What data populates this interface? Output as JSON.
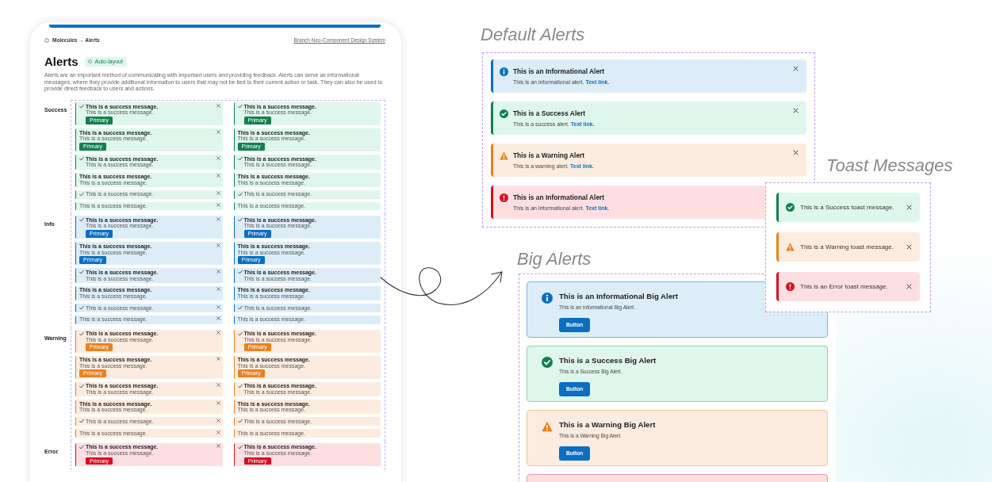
{
  "doc_page": {
    "breadcrumb": "Molecules → Alerts",
    "branch_link": "Branch Neo-Component Design System",
    "title": "Alerts",
    "badge": "Auto-layout",
    "description": "Alerts are an important method of communicating with important users and providing feedback. Alerts can serve as informational messages, where they provide additional information to users that may not be tied to their current action or task. They can also be used to provide direct feedback to users and actions.",
    "groups": [
      {
        "label": "Success",
        "kind": "success",
        "columns": [
          [
            {
              "check_icon": true,
              "title": "This is a success message.",
              "body": "This is a success message.",
              "button": "Primary",
              "close": true
            },
            {
              "check_icon": false,
              "title": "This is a success message.",
              "body": "This is a success message.",
              "button": "Primary",
              "close": true
            },
            {
              "check_icon": true,
              "title": "This is a success message.",
              "body": "This is a success message.",
              "close": true
            },
            {
              "check_icon": false,
              "title": "This is a success message.",
              "body": "This is a success message.",
              "close": true
            },
            {
              "check_icon": true,
              "text": "This is a success message.",
              "close": true
            },
            {
              "check_icon": false,
              "text": "This is a success message.",
              "close": true
            }
          ],
          [
            {
              "check_icon": true,
              "title": "This is a success message.",
              "body": "This is a success message.",
              "button": "Primary",
              "close": false
            },
            {
              "check_icon": false,
              "title": "This is a success message.",
              "body": "This is a success message.",
              "button": "Primary",
              "close": false
            },
            {
              "check_icon": true,
              "title": "This is a success message.",
              "body": "This is a success message.",
              "close": false
            },
            {
              "check_icon": false,
              "title": "This is a success message.",
              "body": "This is a success message.",
              "close": false
            },
            {
              "check_icon": true,
              "text": "This is a success message.",
              "close": false
            },
            {
              "check_icon": false,
              "text": "This is a success message.",
              "close": false
            }
          ]
        ]
      },
      {
        "label": "Info",
        "kind": "info",
        "columns": [
          [
            {
              "check_icon": true,
              "title": "This is a success message.",
              "body": "This is a success message.",
              "button": "Primary",
              "close": true
            },
            {
              "check_icon": false,
              "title": "This is a success message.",
              "body": "This is a success message.",
              "button": "Primary",
              "close": true
            },
            {
              "check_icon": true,
              "title": "This is a success message.",
              "body": "This is a success message.",
              "close": true
            },
            {
              "check_icon": false,
              "title": "This is a success message.",
              "body": "This is a success message.",
              "close": true
            },
            {
              "check_icon": true,
              "text": "This is a success message.",
              "close": true
            },
            {
              "check_icon": false,
              "text": "This is a success message.",
              "close": true
            }
          ],
          [
            {
              "check_icon": true,
              "title": "This is a success message.",
              "body": "This is a success message.",
              "button": "Primary",
              "close": false
            },
            {
              "check_icon": false,
              "title": "This is a success message.",
              "body": "This is a success message.",
              "button": "Primary",
              "close": false
            },
            {
              "check_icon": true,
              "title": "This is a success message.",
              "body": "This is a success message.",
              "close": false
            },
            {
              "check_icon": false,
              "title": "This is a success message.",
              "body": "This is a success message.",
              "close": false
            },
            {
              "check_icon": true,
              "text": "This is a success message.",
              "close": false
            },
            {
              "check_icon": false,
              "text": "This is a success message.",
              "close": false
            }
          ]
        ]
      },
      {
        "label": "Warning",
        "kind": "warning",
        "columns": [
          [
            {
              "check_icon": true,
              "title": "This is a success message.",
              "body": "This is a success message.",
              "button": "Primary",
              "close": true
            },
            {
              "check_icon": false,
              "title": "This is a success message.",
              "body": "This is a success message.",
              "button": "Primary",
              "close": true
            },
            {
              "check_icon": true,
              "title": "This is a success message.",
              "body": "This is a success message.",
              "close": true
            },
            {
              "check_icon": false,
              "title": "This is a success message.",
              "body": "This is a success message.",
              "close": true
            },
            {
              "check_icon": true,
              "text": "This is a success message.",
              "close": true
            },
            {
              "check_icon": false,
              "text": "This is a success message.",
              "close": true
            }
          ],
          [
            {
              "check_icon": true,
              "title": "This is a success message.",
              "body": "This is a success message.",
              "button": "Primary",
              "close": false
            },
            {
              "check_icon": false,
              "title": "This is a success message.",
              "body": "This is a success message.",
              "button": "Primary",
              "close": false
            },
            {
              "check_icon": true,
              "title": "This is a success message.",
              "body": "This is a success message.",
              "close": false
            },
            {
              "check_icon": false,
              "title": "This is a success message.",
              "body": "This is a success message.",
              "close": false
            },
            {
              "check_icon": true,
              "text": "This is a success message.",
              "close": false
            },
            {
              "check_icon": false,
              "text": "This is a success message.",
              "close": false
            }
          ]
        ]
      },
      {
        "label": "Error",
        "kind": "error",
        "columns": [
          [
            {
              "check_icon": true,
              "title": "This is a success message.",
              "body": "This is a success message.",
              "button": "Primary",
              "close": true
            }
          ],
          [
            {
              "check_icon": true,
              "title": "This is a success message.",
              "body": "This is a success message.",
              "button": "Primary",
              "close": false
            }
          ]
        ]
      }
    ]
  },
  "default_alerts": {
    "heading": "Default Alerts",
    "alerts": [
      {
        "kind": "info",
        "title": "This is an Informational Alert",
        "message": "This is an informational alert.",
        "link": "Text link.",
        "close": true
      },
      {
        "kind": "success",
        "title": "This is a Success Alert",
        "message": "This is a success alert.",
        "link": "Text link.",
        "close": true
      },
      {
        "kind": "warning",
        "title": "This is a Warning Alert",
        "message": "This is a warning alert.",
        "link": "Text link.",
        "close": true
      },
      {
        "kind": "error",
        "title": "This is an Informational Alert",
        "message": "This is an informational alert.",
        "link": "Text link.",
        "close": false
      }
    ]
  },
  "toast_messages": {
    "heading": "Toast Messages",
    "toasts": [
      {
        "kind": "success",
        "message": "This is a Success toast message.",
        "close": true
      },
      {
        "kind": "warning",
        "message": "This is a Warning toast message.",
        "close": true
      },
      {
        "kind": "error",
        "message": "This is an Error toast message.",
        "close": true
      }
    ]
  },
  "big_alerts": {
    "heading": "Big Alerts",
    "alerts": [
      {
        "kind": "info",
        "title": "This is an Informational Big Alert",
        "message": "This is an informational Big Alert.",
        "button": "Button"
      },
      {
        "kind": "success",
        "title": "This is a Success Big Alert",
        "message": "This is a Success Big Alert.",
        "button": "Button"
      },
      {
        "kind": "warning",
        "title": "This is a Warning Big Alert",
        "message": "This is a Warning Big Alert.",
        "button": "Button"
      },
      {
        "kind": "error"
      }
    ]
  }
}
